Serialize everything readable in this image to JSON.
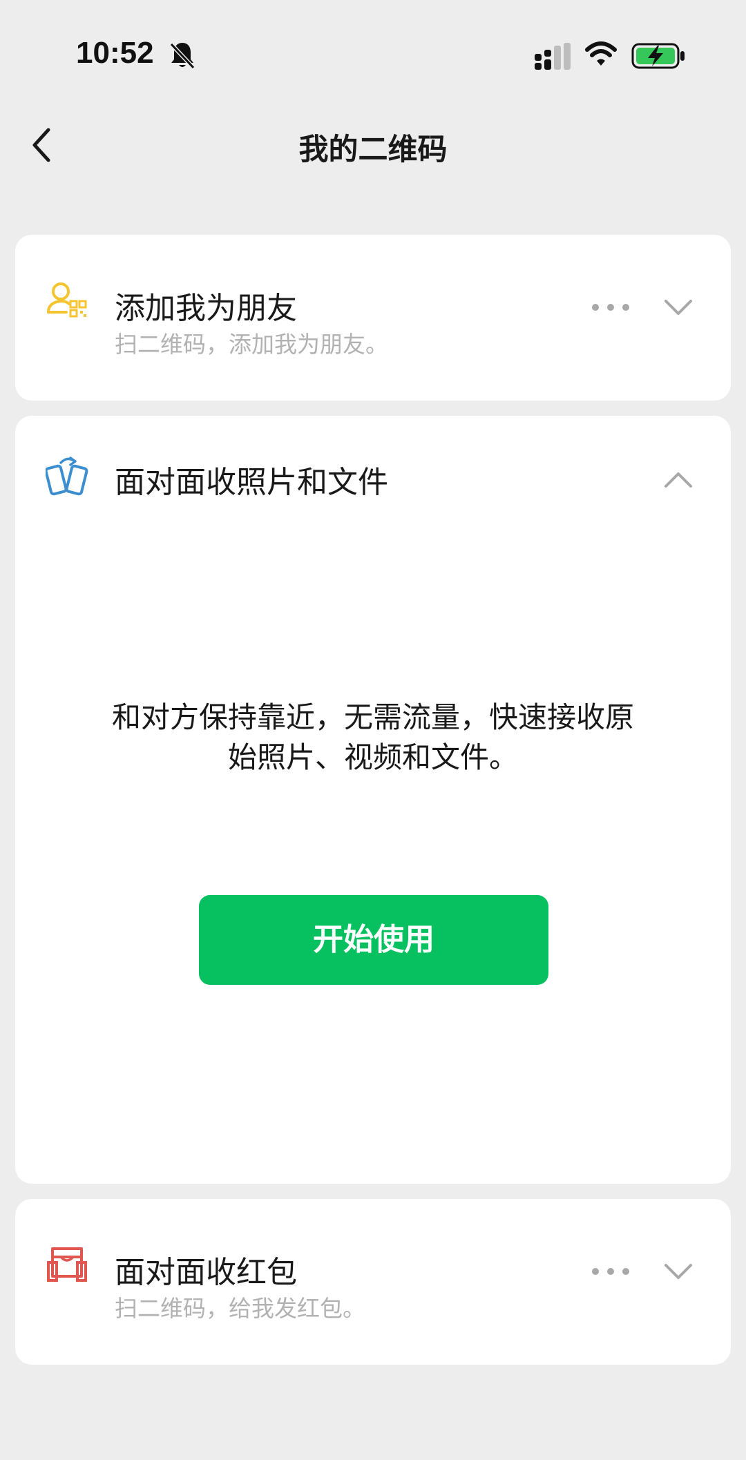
{
  "status_bar": {
    "time": "10:52",
    "icons": [
      "bell-slash-icon",
      "signal-icon",
      "wifi-icon",
      "battery-charging-icon"
    ]
  },
  "nav": {
    "back_icon": "chevron-left-icon",
    "title": "我的二维码"
  },
  "sections": {
    "add_friend": {
      "icon": "user-qrcode-icon",
      "title": "添加我为朋友",
      "subtitle": "扫二维码，添加我为朋友。",
      "icon_color": "#f4c431",
      "expanded": false
    },
    "face_to_face_files": {
      "icon": "phone-transfer-icon",
      "title": "面对面收照片和文件",
      "icon_color": "#3b8ed0",
      "expanded": true,
      "description_line1": "和对方保持靠近，无需流量，快速接收原",
      "description_line2": "始照片、视频和文件。",
      "button_label": "开始使用",
      "button_color": "#07c160"
    },
    "red_packet": {
      "icon": "red-packet-icon",
      "title": "面对面收红包",
      "subtitle": "扫二维码，给我发红包。",
      "icon_color": "#e0574f",
      "expanded": false
    }
  },
  "colors": {
    "background": "#ededed",
    "card": "#ffffff",
    "subtitle_gray": "#b2b2b2"
  }
}
